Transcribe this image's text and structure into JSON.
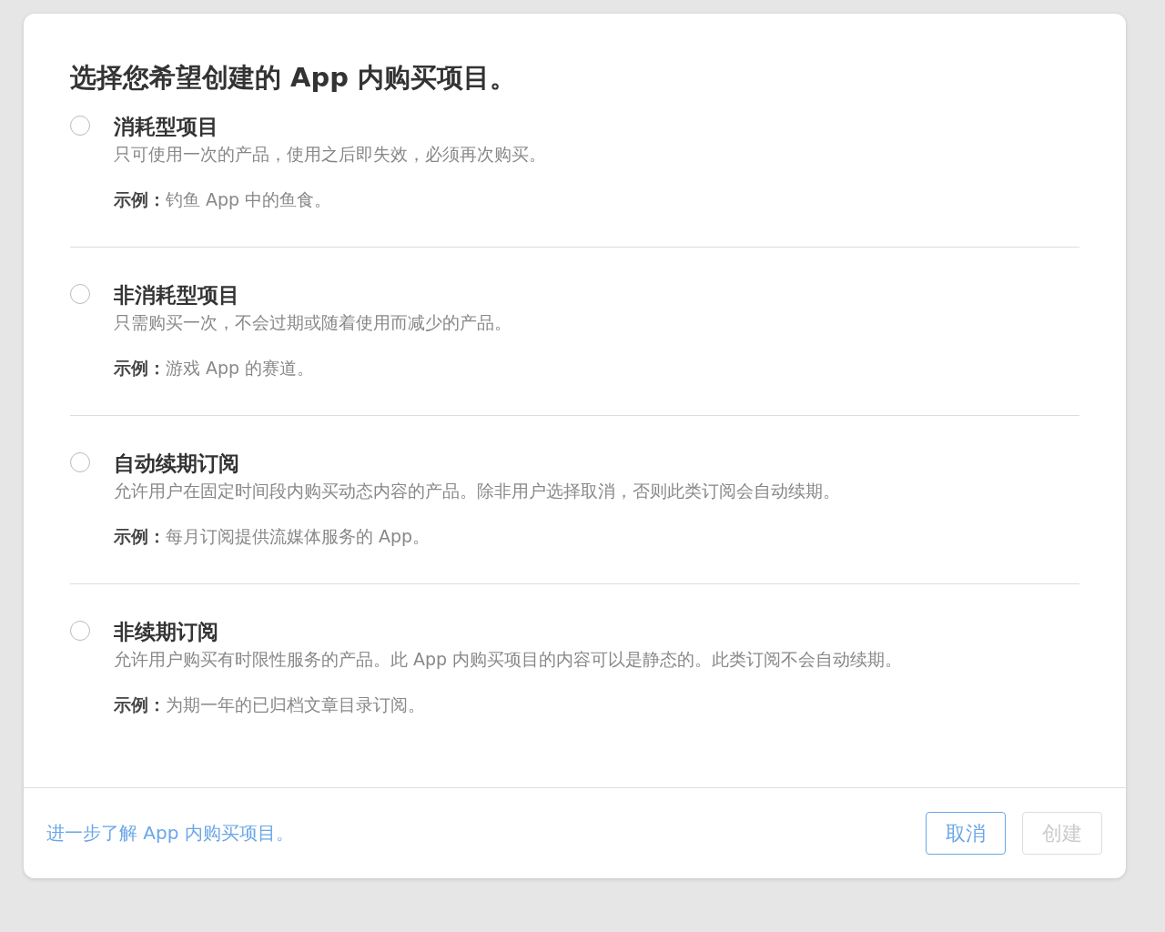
{
  "dialog": {
    "title": "选择您希望创建的 App 内购买项目。",
    "options": [
      {
        "label": "消耗型项目",
        "description": "只可使用一次的产品，使用之后即失效，必须再次购买。",
        "example": "**示例：**钓鱼 App 中的鱼食。",
        "selected": false
      },
      {
        "label": "非消耗型项目",
        "description": "只需购买一次，不会过期或随着使用而减少的产品。",
        "example": "**示例：**游戏 App 的赛道。",
        "selected": false
      },
      {
        "label": "自动续期订阅",
        "description": "允许用户在固定时间段内购买动态内容的产品。除非用户选择取消，否则此类订阅会自动续期。",
        "example": "**示例：**每月订阅提供流媒体服务的 App。",
        "selected": false
      },
      {
        "label": "非续期订阅",
        "description": "允许用户购买有时限性服务的产品。此 App 内购买项目的内容可以是静态的。此类订阅不会自动续期。",
        "example": "**示例：**为期一年的已归档文章目录订阅。",
        "selected": false
      }
    ],
    "footer_link": "进一步了解 App 内购买项目。",
    "buttons": [
      {
        "label": "取消",
        "disabled": false
      },
      {
        "label": "创建",
        "disabled": true
      }
    ]
  }
}
